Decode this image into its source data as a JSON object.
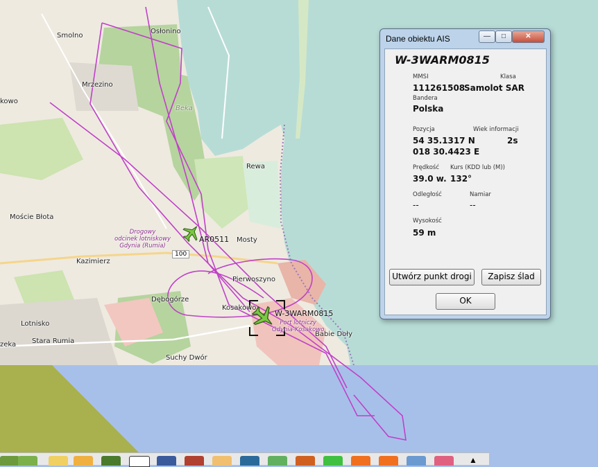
{
  "map": {
    "labels": {
      "smolno": "Smolno",
      "oslonino": "Osłonino",
      "mrzezino": "Mrzezino",
      "beka": "Beka",
      "rewa": "Rewa",
      "moscie_bloto": "Moście Błota",
      "mosty": "Mosty",
      "kazimierz": "Kazimierz",
      "pierwoszyno": "Pierwoszyno",
      "debogorze": "Dębogórze",
      "kosakowo": "Kosakowo",
      "lotnisko": "Lotnisko",
      "stara_rumia": "Stara Rumia",
      "suchy_dwor": "Suchy Dwór",
      "babie_doly": "Babie Doły",
      "zeka": "zeka",
      "kowo": "kowo",
      "runway_1": "Drogowy",
      "runway_2": "odcinek lotniskowy",
      "runway_3": "Gdynia (Rumia)",
      "airport_1": "Port lotniczy",
      "airport_2": "Gdynia-Kosakowo",
      "road_100": "100"
    },
    "vessels": [
      {
        "label": "AR0511",
        "icon": "airplane-icon"
      },
      {
        "label": "W-3WARM0815",
        "icon": "airplane-icon",
        "selected": true
      }
    ],
    "colors": {
      "track": "#c040c8",
      "sea": "#a7c0ea",
      "bay": "#b7dcd6",
      "land": "#eeeae0",
      "forest": "#b6d49e"
    }
  },
  "dialog": {
    "title": "Dane obiektu AIS",
    "vessel_name": "W-3WARM0815",
    "mmsi_label": "MMSI",
    "mmsi_value": "111261508",
    "class_label": "Klasa",
    "class_value": "Samolot SAR",
    "flag_label": "Bandera",
    "flag_value": "Polska",
    "position_label": "Pozycja",
    "lat_value": "54 35.1317 N",
    "lon_value": "018 30.4423 E",
    "age_label": "Wiek informacji",
    "age_value": "2s",
    "speed_label": "Prędkość",
    "speed_value": "39.0 w.",
    "course_label": "Kurs (KDD lub (M))",
    "course_value": "132°",
    "distance_label": "Odległość",
    "distance_value": "--",
    "bearing_label": "Namiar",
    "bearing_value": "--",
    "altitude_label": "Wysokość",
    "altitude_value": "59 m",
    "create_waypoint_label": "Utwórz punkt drogi",
    "save_track_label": "Zapisz ślad",
    "ok_label": "OK",
    "minimize_label": "—",
    "maximize_label": "□",
    "close_label": "✕"
  }
}
